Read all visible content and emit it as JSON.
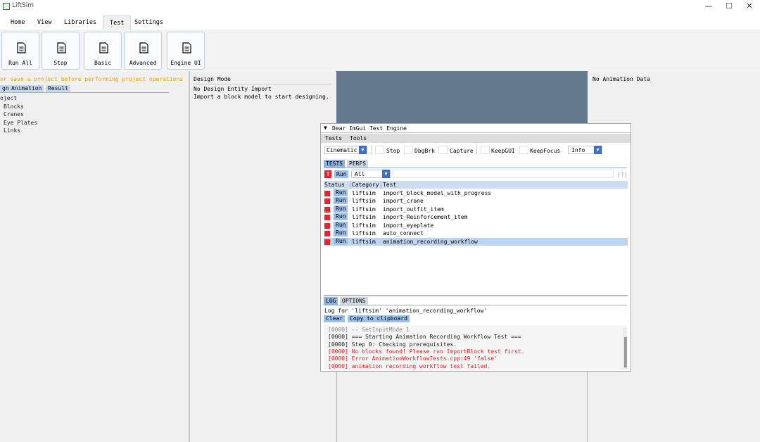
{
  "window": {
    "title": "LiftSim",
    "controls": [
      "—",
      "☐",
      "✕"
    ]
  },
  "menu_tabs": [
    "Home",
    "View",
    "Libraries",
    "Test",
    "Settings"
  ],
  "active_tab": "Test",
  "ribbon_buttons": [
    "Run All",
    "Stop",
    "Basic",
    "Advanced",
    "Engine UI"
  ],
  "left_panel": {
    "warning": "or save a project before performing project operations",
    "tabs": [
      "gn",
      "Animation",
      "Result"
    ],
    "tree": [
      "oject",
      "Blocks",
      "Cranes",
      "Eye Plates",
      "Links"
    ]
  },
  "design_panel": {
    "title": "Design Mode",
    "line1": "No Design Entity Import",
    "line2": "Import a block model to start designing."
  },
  "right_panel": {
    "text": "No Animation Data"
  },
  "test_engine": {
    "title": "Dear ImGui Test Engine",
    "menu": [
      "Tests",
      "Tools"
    ],
    "toolbar": {
      "mode": "Cinematic",
      "checks": [
        "Stop",
        "DbgBrk",
        "Capture",
        "KeepGUI",
        "KeepFocus"
      ],
      "verbosity": "Info"
    },
    "tabs": [
      "TESTS",
      "PERFS"
    ],
    "filter": {
      "question_mark": "T",
      "run": "Run",
      "combo": "All",
      "help": "(?)"
    },
    "columns": [
      "Status",
      "Category",
      "Test"
    ],
    "rows": [
      {
        "run": "Run",
        "category": "liftsim",
        "test": "import_block_model_with_progress"
      },
      {
        "run": "Run",
        "category": "liftsim",
        "test": "import_crane"
      },
      {
        "run": "Run",
        "category": "liftsim",
        "test": "import_outfit_item"
      },
      {
        "run": "Run",
        "category": "liftsim",
        "test": "import_Reinforcement_item"
      },
      {
        "run": "Run",
        "category": "liftsim",
        "test": "import_eyeplate"
      },
      {
        "run": "Run",
        "category": "liftsim",
        "test": "auto_connect"
      },
      {
        "run": "Run",
        "category": "liftsim",
        "test": "animation_recording_workflow"
      }
    ],
    "log_tabs": [
      "LOG",
      "OPTIONS"
    ],
    "log_header": "Log for 'liftsim' 'animation_recording_workflow'",
    "log_buttons": [
      "Clear",
      "Copy to clipboard"
    ],
    "log_lines": [
      {
        "text": "[0000] -- SetInputMode 1",
        "color": "#888888"
      },
      {
        "text": "[0000] === Starting Animation Recording Workflow Test ===",
        "color": "#202020"
      },
      {
        "text": "[0000] Step 0: Checking prerequisites.",
        "color": "#202020"
      },
      {
        "text": "[0000] No blocks found! Please run ImportBlock test first.",
        "color": "#e02020"
      },
      {
        "text": "[0000] Error AnimationWorkflowTests.cpp:49 'false'",
        "color": "#e02020"
      },
      {
        "text": "[0000] animation recording workflow test failed.",
        "color": "#e02020"
      }
    ]
  },
  "colors": {
    "accent": "#3d6fc4",
    "fail": "#e0252b",
    "warning": "#f4a000",
    "viewport": "#64788e"
  }
}
